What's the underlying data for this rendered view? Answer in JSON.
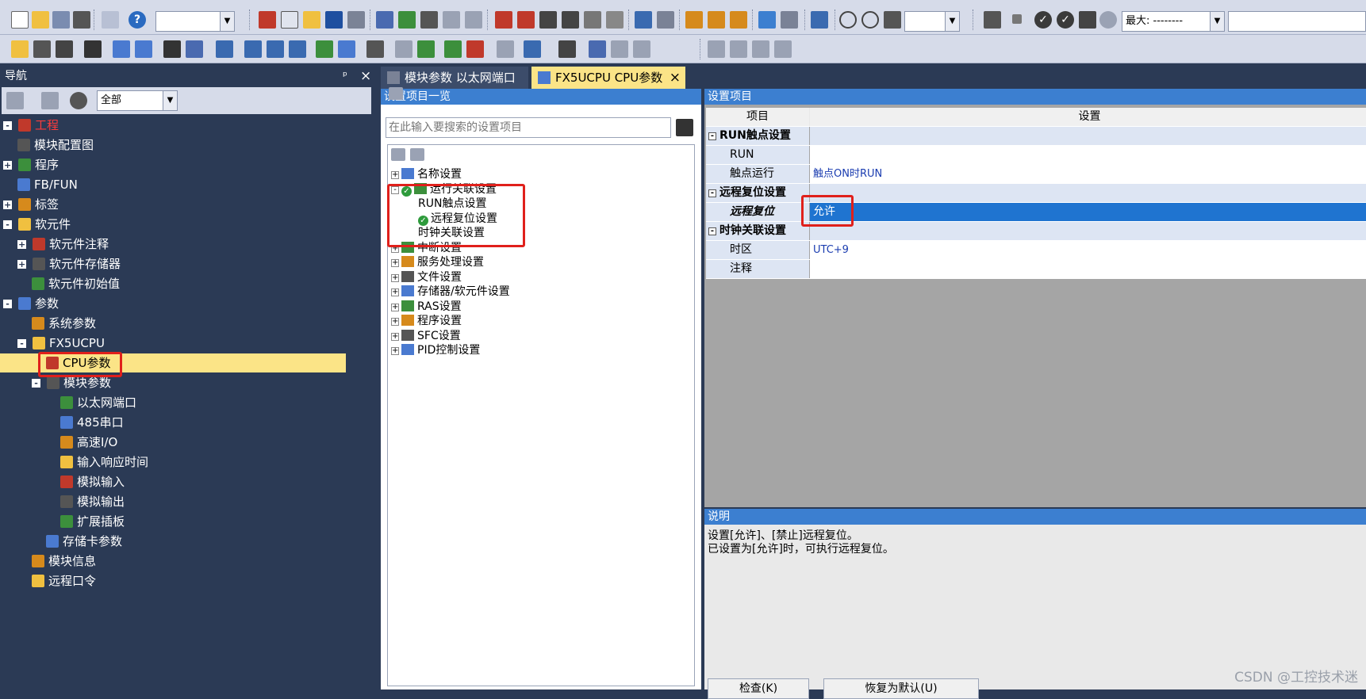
{
  "toolbar": {
    "zoom_combo": "",
    "max_label": "最大: --------",
    "filter_combo": "全部"
  },
  "nav": {
    "title": "导航",
    "pin": "ᵖ",
    "close": "×",
    "filter": "全部",
    "tree": [
      {
        "label": "工程",
        "level": 0,
        "exp": "-",
        "color": "#ff3b3b"
      },
      {
        "label": "模块配置图",
        "level": 1,
        "exp": ""
      },
      {
        "label": "程序",
        "level": 0,
        "exp": "+"
      },
      {
        "label": "FB/FUN",
        "level": 1,
        "exp": ""
      },
      {
        "label": "标签",
        "level": 0,
        "exp": "+"
      },
      {
        "label": "软元件",
        "level": 0,
        "exp": "-"
      },
      {
        "label": "软元件注释",
        "level": 1,
        "exp": "+"
      },
      {
        "label": "软元件存储器",
        "level": 1,
        "exp": "+"
      },
      {
        "label": "软元件初始值",
        "level": 2,
        "exp": ""
      },
      {
        "label": "参数",
        "level": 0,
        "exp": "-"
      },
      {
        "label": "系统参数",
        "level": 2,
        "exp": ""
      },
      {
        "label": "FX5UCPU",
        "level": 1,
        "exp": "-"
      },
      {
        "label": "CPU参数",
        "level": 3,
        "exp": "",
        "selected": true
      },
      {
        "label": "模块参数",
        "level": 2,
        "exp": "-"
      },
      {
        "label": "以太网端口",
        "level": 4,
        "exp": ""
      },
      {
        "label": "485串口",
        "level": 4,
        "exp": ""
      },
      {
        "label": "高速I/O",
        "level": 4,
        "exp": ""
      },
      {
        "label": "输入响应时间",
        "level": 4,
        "exp": ""
      },
      {
        "label": "模拟输入",
        "level": 4,
        "exp": ""
      },
      {
        "label": "模拟输出",
        "level": 4,
        "exp": ""
      },
      {
        "label": "扩展插板",
        "level": 4,
        "exp": ""
      },
      {
        "label": "存储卡参数",
        "level": 3,
        "exp": ""
      },
      {
        "label": "模块信息",
        "level": 2,
        "exp": ""
      },
      {
        "label": "远程口令",
        "level": 2,
        "exp": ""
      }
    ]
  },
  "tabs": [
    {
      "label": "模块参数 以太网端口",
      "active": false
    },
    {
      "label": "FX5UCPU CPU参数",
      "active": true,
      "close": "×"
    }
  ],
  "list": {
    "title": "设置项目一览",
    "search_placeholder": "在此输入要搜索的设置项目",
    "items": [
      {
        "label": "名称设置",
        "level": 0,
        "exp": "+"
      },
      {
        "label": "运行关联设置",
        "level": 0,
        "exp": "-",
        "checked": true
      },
      {
        "label": "RUN触点设置",
        "level": 1,
        "exp": ""
      },
      {
        "label": "远程复位设置",
        "level": 1,
        "exp": "",
        "checked": true
      },
      {
        "label": "时钟关联设置",
        "level": 1,
        "exp": ""
      },
      {
        "label": "中断设置",
        "level": 0,
        "exp": "+"
      },
      {
        "label": "服务处理设置",
        "level": 0,
        "exp": "+"
      },
      {
        "label": "文件设置",
        "level": 0,
        "exp": "+"
      },
      {
        "label": "存储器/软元件设置",
        "level": 0,
        "exp": "+"
      },
      {
        "label": "RAS设置",
        "level": 0,
        "exp": "+"
      },
      {
        "label": "程序设置",
        "level": 0,
        "exp": "+"
      },
      {
        "label": "SFC设置",
        "level": 0,
        "exp": "+"
      },
      {
        "label": "PID控制设置",
        "level": 0,
        "exp": "+"
      }
    ]
  },
  "grid": {
    "title": "设置项目",
    "col_item": "项目",
    "col_setting": "设置",
    "rows": [
      {
        "item": "RUN触点设置",
        "value": "",
        "group": true
      },
      {
        "item": "RUN",
        "value": ""
      },
      {
        "item": "触点运行",
        "value": "触点ON时RUN"
      },
      {
        "item": "远程复位设置",
        "value": "",
        "group": true
      },
      {
        "item": "远程复位",
        "value": "允许",
        "selected": true
      },
      {
        "item": "时钟关联设置",
        "value": "",
        "group": true
      },
      {
        "item": "时区",
        "value": "UTC+9"
      },
      {
        "item": "注释",
        "value": ""
      }
    ]
  },
  "description": {
    "title": "说明",
    "text": "设置[允许]、[禁止]远程复位。\n已设置为[允许]时，可执行远程复位。",
    "check_button": "检查(K)",
    "restore_button": "恢复为默认(U)"
  },
  "watermark": "CSDN @工控技术迷",
  "colors": {
    "accent": "#3c7fd0",
    "highlight": "#fbe487",
    "red_box": "#e0201b",
    "selected_row": "#1f74d0"
  }
}
